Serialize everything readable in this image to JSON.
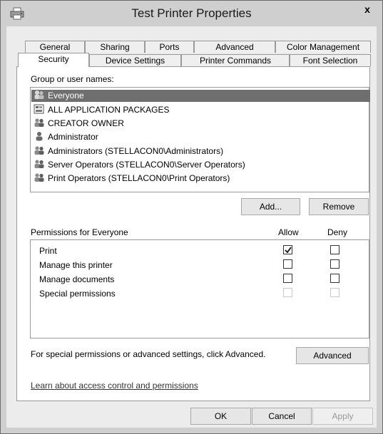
{
  "window": {
    "title": "Test Printer Properties",
    "close_label": "x"
  },
  "tabs_row1": [
    {
      "label": "General"
    },
    {
      "label": "Sharing"
    },
    {
      "label": "Ports"
    },
    {
      "label": "Advanced"
    },
    {
      "label": "Color Management"
    }
  ],
  "tabs_row2": [
    {
      "label": "Security",
      "selected": true
    },
    {
      "label": "Device Settings"
    },
    {
      "label": "Printer Commands"
    },
    {
      "label": "Font Selection"
    }
  ],
  "security": {
    "group_label": "Group or user names:",
    "users": [
      {
        "name": "Everyone",
        "icon": "group-icon",
        "selected": true
      },
      {
        "name": "ALL APPLICATION PACKAGES",
        "icon": "packages-icon"
      },
      {
        "name": "CREATOR OWNER",
        "icon": "group-icon"
      },
      {
        "name": "Administrator",
        "icon": "user-icon"
      },
      {
        "name": "Administrators (STELLACON0\\Administrators)",
        "icon": "group-icon"
      },
      {
        "name": "Server Operators (STELLACON0\\Server Operators)",
        "icon": "group-icon"
      },
      {
        "name": "Print Operators (STELLACON0\\Print Operators)",
        "icon": "group-icon"
      }
    ],
    "add_label": "Add...",
    "remove_label": "Remove",
    "permissions_label": "Permissions for Everyone",
    "allow_header": "Allow",
    "deny_header": "Deny",
    "permissions": [
      {
        "name": "Print",
        "allow": true,
        "deny": false,
        "enabled": true
      },
      {
        "name": "Manage this printer",
        "allow": false,
        "deny": false,
        "enabled": true
      },
      {
        "name": "Manage documents",
        "allow": false,
        "deny": false,
        "enabled": true
      },
      {
        "name": "Special permissions",
        "allow": false,
        "deny": false,
        "enabled": false
      }
    ],
    "advanced_hint": "For special permissions or advanced settings, click Advanced.",
    "advanced_label": "Advanced",
    "learn_link": "Learn about access control and permissions"
  },
  "footer": {
    "ok_label": "OK",
    "cancel_label": "Cancel",
    "apply_label": "Apply",
    "apply_enabled": false
  }
}
